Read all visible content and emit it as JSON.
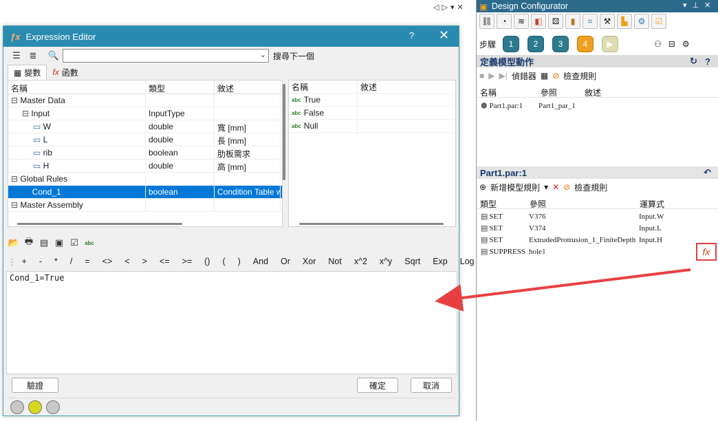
{
  "top_nav": {
    "back": "◁",
    "forward": "▷",
    "menu": "▾",
    "close": "✕"
  },
  "expression_editor": {
    "title": "Expression Editor",
    "help": "?",
    "close": "✕",
    "search": {
      "value": "",
      "placeholder": ""
    },
    "find_next": "搜尋下一個",
    "tabs": [
      {
        "label": "變數",
        "icon": "variables-icon"
      },
      {
        "label": "函數",
        "icon": "fx-icon"
      }
    ],
    "tree_headers": [
      "名稱",
      "類型",
      "敘述"
    ],
    "tree_rows": [
      {
        "name": "Master Data",
        "type": "",
        "desc": "",
        "level": 0,
        "icon": "⊟",
        "selected": false
      },
      {
        "name": "Input",
        "type": "InputType",
        "desc": "",
        "level": 1,
        "icon": "⊟",
        "selected": false
      },
      {
        "name": "W",
        "type": "double",
        "desc": "寬 [mm]",
        "level": 2,
        "icon": "",
        "selected": false
      },
      {
        "name": "L",
        "type": "double",
        "desc": "長 [mm]",
        "level": 2,
        "icon": "",
        "selected": false
      },
      {
        "name": "rib",
        "type": "boolean",
        "desc": "肋板需求",
        "level": 2,
        "icon": "",
        "selected": false
      },
      {
        "name": "H",
        "type": "double",
        "desc": "高 [mm]",
        "level": 2,
        "icon": "",
        "selected": false
      },
      {
        "name": "Global Rules",
        "type": "",
        "desc": "",
        "level": 0,
        "icon": "⊟",
        "selected": false
      },
      {
        "name": "Cond_1",
        "type": "boolean",
        "desc": "Condition Table w",
        "level": 1,
        "icon": "",
        "selected": true
      },
      {
        "name": "Master Assembly",
        "type": "",
        "desc": "",
        "level": 0,
        "icon": "⊟",
        "selected": false
      }
    ],
    "value_headers": [
      "名稱",
      "敘述"
    ],
    "values": [
      {
        "name": "True",
        "desc": ""
      },
      {
        "name": "False",
        "desc": ""
      },
      {
        "name": "Null",
        "desc": ""
      }
    ],
    "operators": [
      "+",
      "-",
      "*",
      "/",
      "=",
      "<>",
      "<",
      ">",
      "<=",
      ">=",
      "()",
      "(",
      ")",
      "And",
      "Or",
      "Xor",
      "Not",
      "x^2",
      "x^y",
      "Sqrt",
      "Exp",
      "Log"
    ],
    "expression": "Cond_1=True",
    "verify_button": "驗證",
    "ok_button": "確定",
    "cancel_button": "取消"
  },
  "design_configurator": {
    "title": "Design Configurator",
    "steps_label": "步驟",
    "steps": [
      "1",
      "2",
      "3",
      "4",
      "▶"
    ],
    "active_step": 4,
    "section1": {
      "title": "定義模型動作",
      "tool_debugger": "偵錯器",
      "tool_check": "檢查規則",
      "headers": [
        "名稱",
        "參照",
        "敘述"
      ],
      "rows": [
        {
          "name": "Part1.par:1",
          "ref": "Part1_par_1",
          "desc": ""
        }
      ]
    },
    "section2": {
      "title": "Part1.par:1",
      "add_rule": "新增模型規則",
      "check_rules": "檢查規則",
      "headers": [
        "類型",
        "參照",
        "運算式"
      ],
      "rows": [
        {
          "type": "SET",
          "ref": "V376",
          "expr": "Input.W"
        },
        {
          "type": "SET",
          "ref": "V374",
          "expr": "Input.L"
        },
        {
          "type": "SET",
          "ref": "ExtrudedProtrusion_1_FiniteDepth",
          "expr": "Input.H"
        },
        {
          "type": "SUPPRESS",
          "ref": "hole1",
          "expr": ""
        }
      ],
      "fx_label": "fx"
    }
  },
  "colors": {
    "accent": "#2a8bb1",
    "selection": "#0078d7",
    "highlight": "#e04040"
  }
}
